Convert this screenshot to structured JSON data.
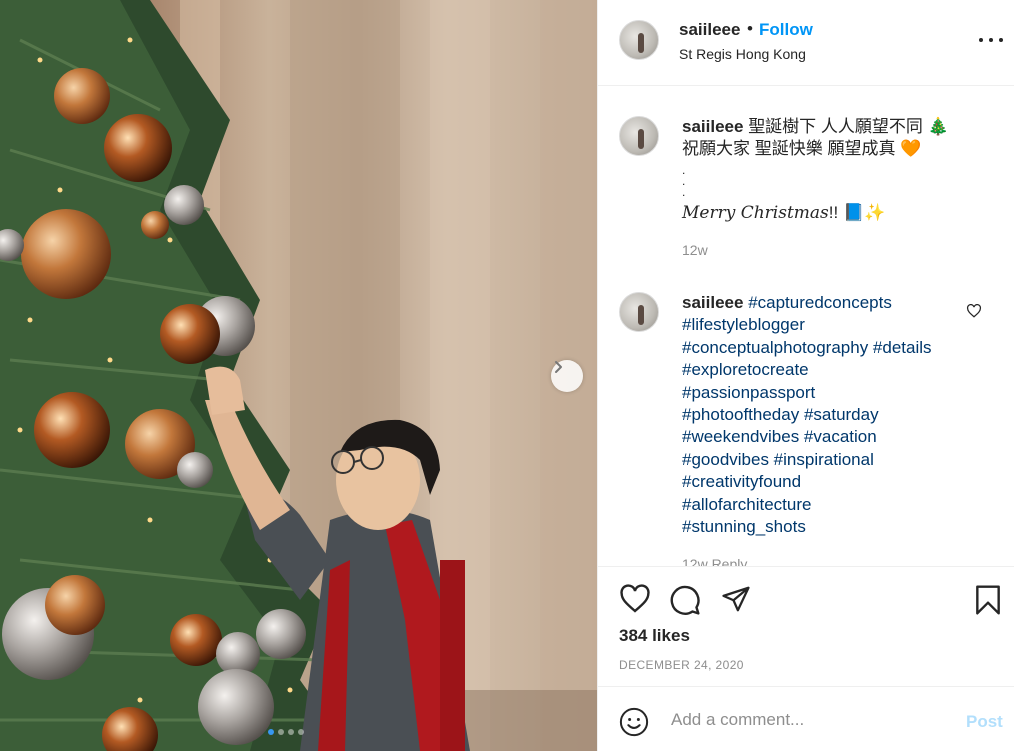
{
  "post": {
    "username": "saiileee",
    "follow_label": "Follow",
    "separator": "•",
    "location": "St Regis Hong Kong"
  },
  "caption": {
    "username": "saiileee",
    "line1": "聖誕樹下 人人願望不同 🎄",
    "line2": "祝願大家 聖誕快樂 願望成真 🧡",
    "dots": ".\n.\n.",
    "merry": "Merry Christmas",
    "merry_suffix": "!! 📘✨",
    "time": "12w"
  },
  "hashtag_comment": {
    "username": "saiileee",
    "first_tag": "#capturedconcepts",
    "tags": [
      "#lifestyleblogger",
      "#conceptualphotography #details",
      "#exploretocreate",
      "#passionpassport",
      "#photooftheday #saturday",
      "#weekendvibes #vacation",
      "#goodvibes #inspirational",
      "#creativityfound",
      "#allofarchitecture",
      "#stunning_shots"
    ],
    "meta_partial": "12w  Reply"
  },
  "engagement": {
    "likes": "384 likes",
    "date": "DECEMBER 24, 2020"
  },
  "comment_box": {
    "placeholder": "Add a comment...",
    "post_label": "Post"
  },
  "carousel": {
    "dot_count": 4,
    "active_index": 0
  },
  "colors": {
    "link_blue": "#0095f6",
    "hashtag": "#00376b",
    "muted": "#8e8e8e",
    "post_disabled": "#b2dffc"
  },
  "icons": [
    "more-options-icon",
    "heart-icon",
    "comment-icon",
    "share-icon",
    "bookmark-icon",
    "emoji-icon",
    "chevron-right-icon",
    "small-heart-icon"
  ]
}
